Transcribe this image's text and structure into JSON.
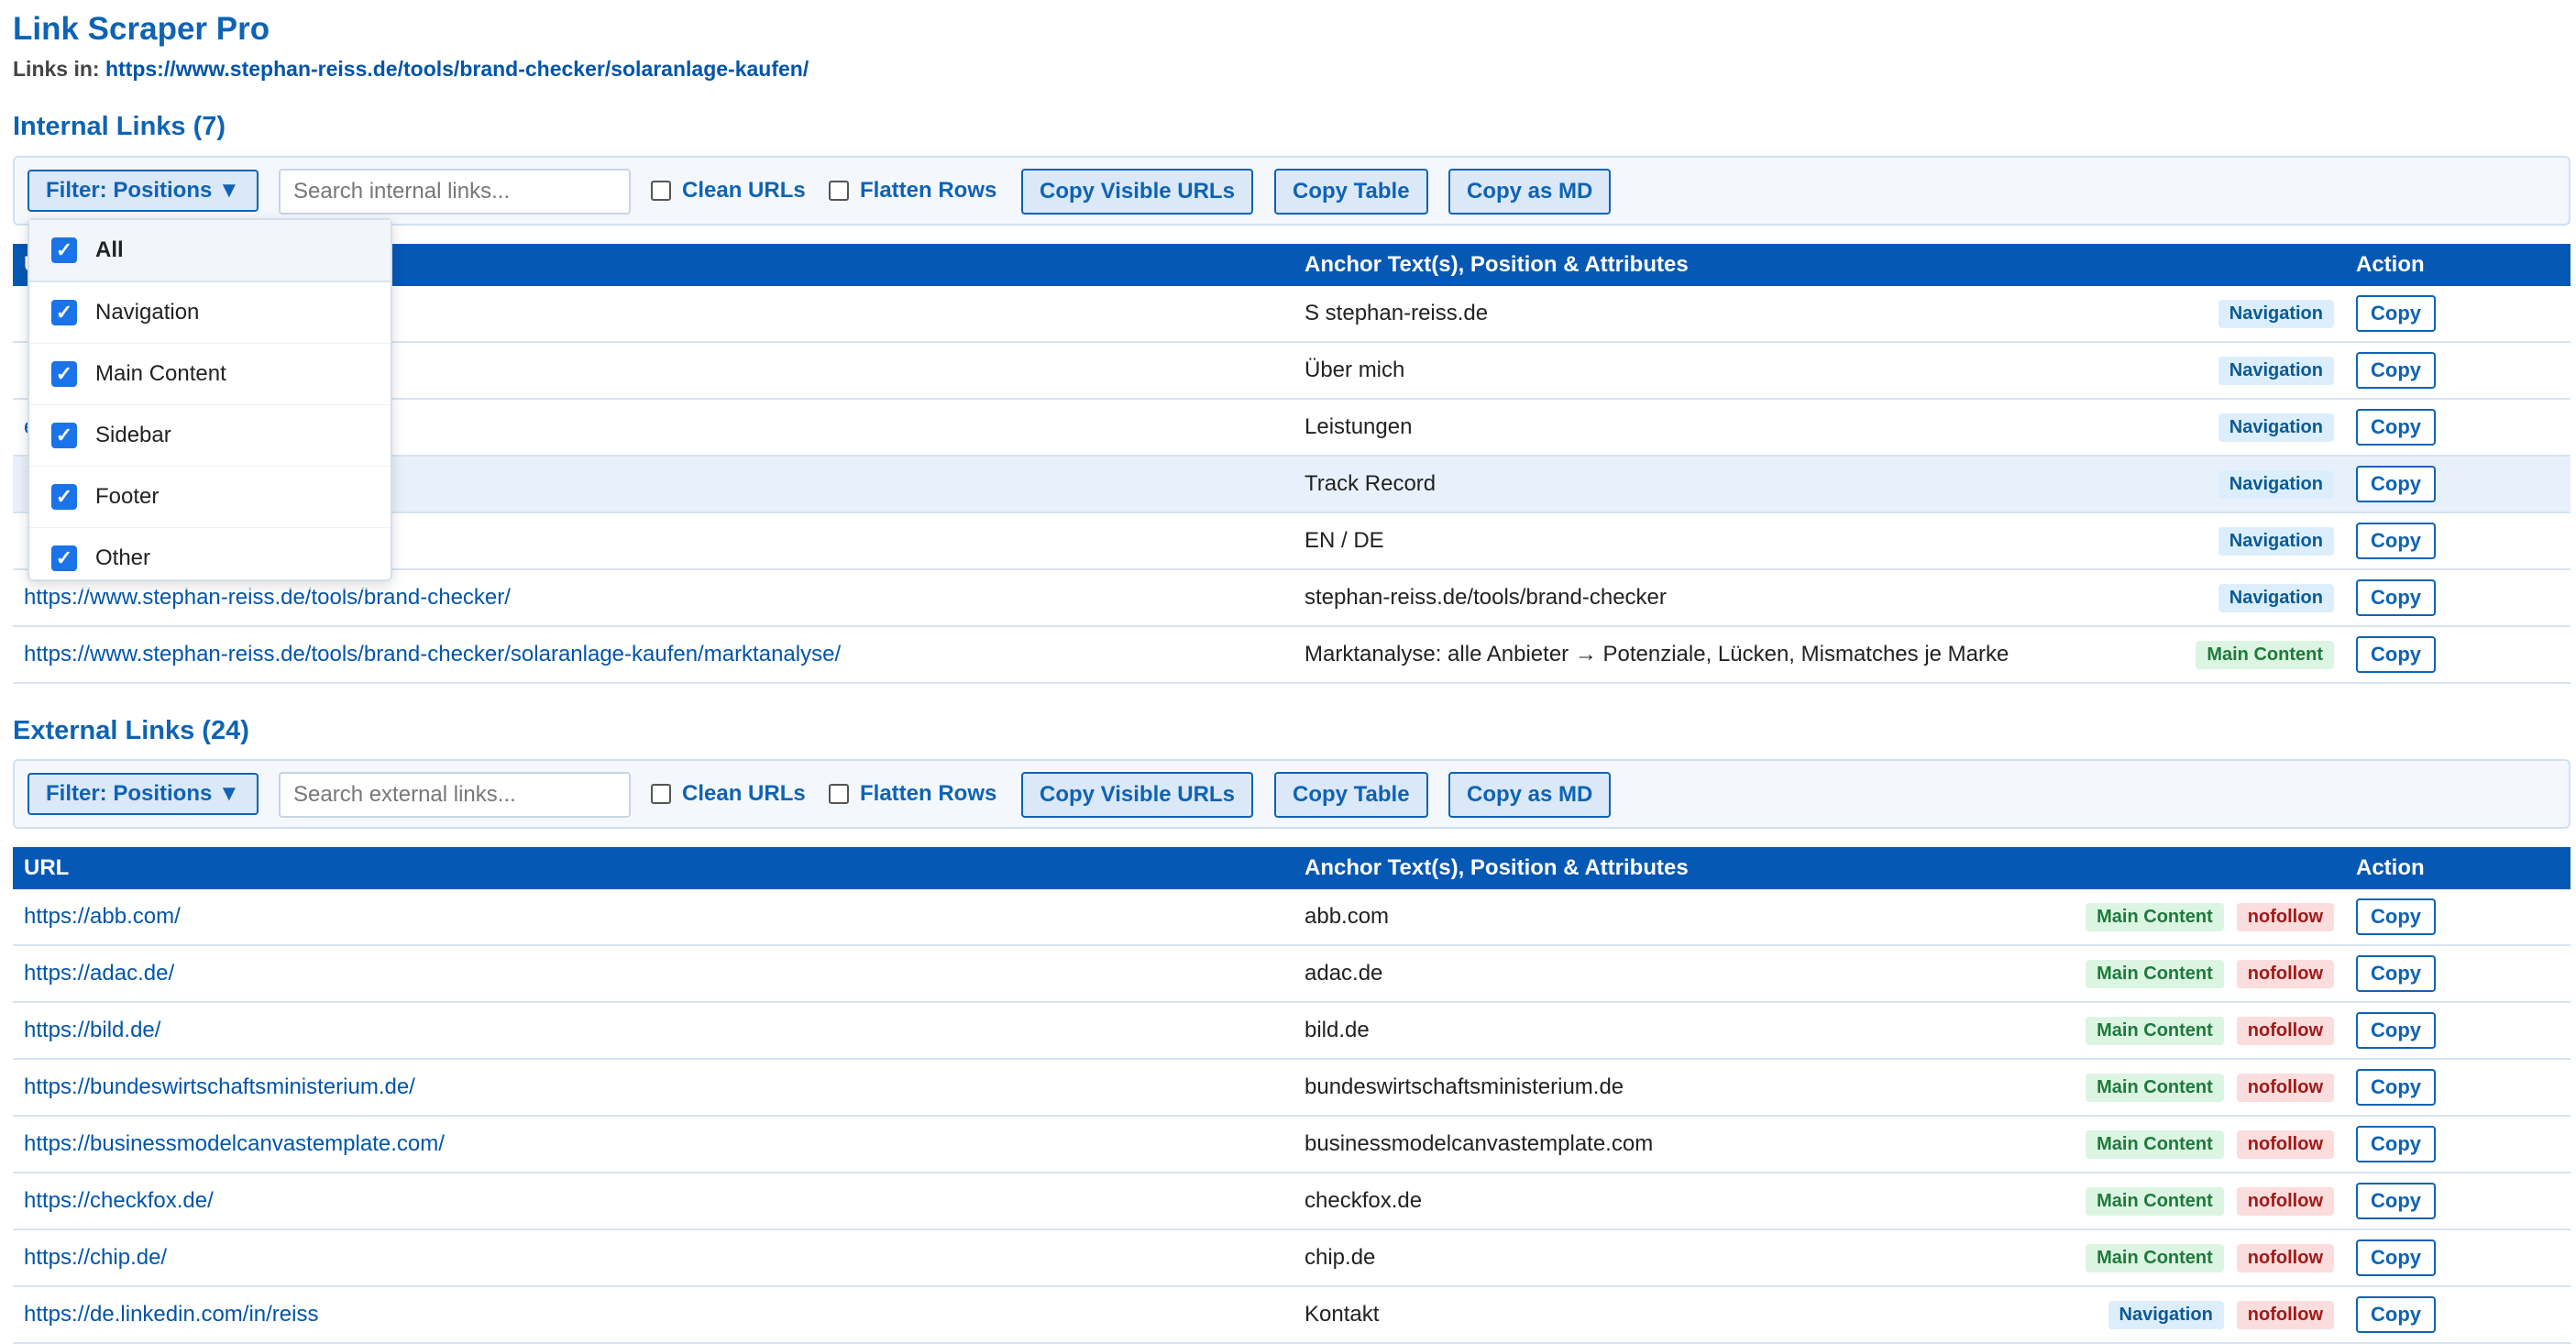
{
  "app": {
    "title": "Link Scraper Pro",
    "links_in_label": "Links in:",
    "source_url": "https://www.stephan-reiss.de/tools/brand-checker/solaranlage-kaufen/"
  },
  "toolbar_labels": {
    "filter": "Filter: Positions ▼",
    "clean_urls": "Clean URLs",
    "flatten_rows": "Flatten Rows",
    "copy_visible": "Copy Visible URLs",
    "copy_table": "Copy Table",
    "copy_md": "Copy as MD"
  },
  "columns": {
    "url": "URL",
    "anchor": "Anchor Text(s), Position & Attributes",
    "action": "Action"
  },
  "copy_label": "Copy",
  "internal": {
    "title": "Internal Links (7)",
    "search_placeholder": "Search internal links...",
    "rows": [
      {
        "url": "",
        "anchor": "S stephan-reiss.de",
        "badges": [
          "Navigation"
        ]
      },
      {
        "url": "",
        "anchor": "Über mich",
        "badges": [
          "Navigation"
        ]
      },
      {
        "url": "es",
        "anchor": "Leistungen",
        "badges": [
          "Navigation"
        ]
      },
      {
        "url": "",
        "anchor": "Track Record",
        "badges": [
          "Navigation"
        ]
      },
      {
        "url": "",
        "anchor": "EN / DE",
        "badges": [
          "Navigation"
        ]
      },
      {
        "url": "https://www.stephan-reiss.de/tools/brand-checker/",
        "anchor": "stephan-reiss.de/tools/brand-checker",
        "badges": [
          "Navigation"
        ]
      },
      {
        "url": "https://www.stephan-reiss.de/tools/brand-checker/solaranlage-kaufen/marktanalyse/",
        "anchor": "Marktanalyse: alle Anbieter → Potenziale, Lücken, Mismatches je Marke",
        "badges": [
          "Main Content"
        ]
      }
    ]
  },
  "external": {
    "title": "External Links (24)",
    "search_placeholder": "Search external links...",
    "rows": [
      {
        "url": "https://abb.com/",
        "anchor": "abb.com",
        "badges": [
          "Main Content",
          "nofollow"
        ]
      },
      {
        "url": "https://adac.de/",
        "anchor": "adac.de",
        "badges": [
          "Main Content",
          "nofollow"
        ]
      },
      {
        "url": "https://bild.de/",
        "anchor": "bild.de",
        "badges": [
          "Main Content",
          "nofollow"
        ]
      },
      {
        "url": "https://bundeswirtschaftsministerium.de/",
        "anchor": "bundeswirtschaftsministerium.de",
        "badges": [
          "Main Content",
          "nofollow"
        ]
      },
      {
        "url": "https://businessmodelcanvastemplate.com/",
        "anchor": "businessmodelcanvastemplate.com",
        "badges": [
          "Main Content",
          "nofollow"
        ]
      },
      {
        "url": "https://checkfox.de/",
        "anchor": "checkfox.de",
        "badges": [
          "Main Content",
          "nofollow"
        ]
      },
      {
        "url": "https://chip.de/",
        "anchor": "chip.de",
        "badges": [
          "Main Content",
          "nofollow"
        ]
      },
      {
        "url": "https://de.linkedin.com/in/reiss",
        "anchor": "Kontakt",
        "badges": [
          "Navigation",
          "nofollow"
        ]
      }
    ]
  },
  "filter_dropdown": {
    "items": [
      {
        "label": "All",
        "checked": true
      },
      {
        "label": "Navigation",
        "checked": true
      },
      {
        "label": "Main Content",
        "checked": true
      },
      {
        "label": "Sidebar",
        "checked": true
      },
      {
        "label": "Footer",
        "checked": true
      },
      {
        "label": "Other",
        "checked": true
      }
    ]
  },
  "colors": {
    "accent": "#0e63b4",
    "header_bg": "#0658b5",
    "nav_badge": "#dceefb",
    "main_badge": "#dcf5e3",
    "nofollow_badge": "#fbdddd"
  }
}
